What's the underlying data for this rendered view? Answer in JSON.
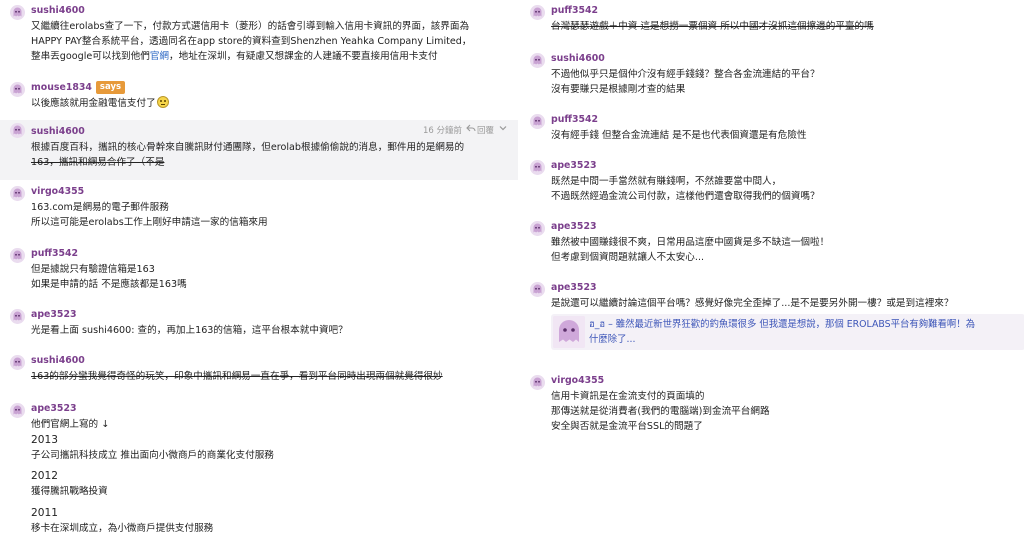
{
  "colors": {
    "username": "#7b3f8c",
    "link": "#2c68c5",
    "badge": "#e79a3a",
    "hover_bg": "#f3f3f5",
    "quote_text": "#3c55b8"
  },
  "icons": {
    "avatar": "ghost-avatar-icon",
    "reply": "reply-arrow-icon",
    "chevron": "chevron-down-icon",
    "emoji": "smiley-emoji-icon"
  },
  "left": [
    {
      "user": "sushi4600",
      "lines": [
        "又繼續往erolabs查了一下，付款方式選信用卡（菱形）的話會引導到輸入信用卡資訊的界面，該界面為",
        "HAPPY PAY整合系統平台，透過同名在app store的資料查到Shenzhen Yeahka Company Limited，",
        "整串丟google可以找到他們"
      ],
      "link_text": "官網",
      "tail": "，地址在深圳，有疑慮又想課金的人建議不要直接用信用卡支付"
    },
    {
      "user": "mouse1834",
      "badge": "says",
      "lines": [
        "以後應該就用金融電信支付了"
      ]
    },
    {
      "user": "sushi4600",
      "time": "16 分鐘前",
      "reply": "回覆",
      "lines": [
        "根據百度百科，攜訊的核心骨幹來自騰訊財付通團隊，但erolab根據偷偷說的消息，郵件用的是網易的"
      ],
      "strike_line": "163，攜訊和網易合作了（不是"
    },
    {
      "user": "virgo4355",
      "lines": [
        "163.com是網易的電子郵件服務",
        "所以這可能是erolabs工作上剛好申請這一家的信箱來用"
      ]
    },
    {
      "user": "puff3542",
      "lines": [
        "但是據說只有驗證信箱是163",
        "如果是申請的話 不是應該都是163嗎"
      ]
    },
    {
      "user": "ape3523",
      "lines": [
        "光是看上面 sushi4600: 查的，再加上163的信箱，這平台根本就中資吧？"
      ]
    },
    {
      "user": "sushi4600",
      "strike_lines": [
        "163的部分蠻我覺得奇怪的玩笑，印象中攜訊和網易一直在爭，看到平台同時出現兩個就覺得很妙"
      ]
    },
    {
      "user": "ape3523",
      "lines": [
        "他們官網上寫的 ↓"
      ],
      "years": [
        {
          "year": "2013",
          "text": "子公司攜訊科技成立 推出面向小微商戶的商業化支付服務"
        },
        {
          "year": "2012",
          "text": "獲得騰訊戰略投資"
        },
        {
          "year": "2011",
          "text": "移卡在深圳成立，為小微商戶提供支付服務"
        }
      ]
    }
  ],
  "right": [
    {
      "user": "puff3542",
      "strike_lines": [
        "台灣瑟瑟遊戲＋中資 這是想撈一票個資 所以中國才沒抓這個擦邊的平臺的嗎"
      ]
    },
    {
      "user": "sushi4600",
      "lines": [
        "不過他似乎只是個仲介沒有經手錢錢？整合各金流連結的平台？",
        "沒有要賺只是根據剛才查的結果"
      ]
    },
    {
      "user": "puff3542",
      "lines": [
        "沒有經手錢 但整合金流連結 是不是也代表個資還是有危險性"
      ]
    },
    {
      "user": "ape3523",
      "lines": [
        "既然是中間一手當然就有賺錢啊，不然誰要當中間人，",
        "不過既然經過金流公司付款，這樣他們還會取得我們的個資嗎？"
      ]
    },
    {
      "user": "ape3523",
      "lines": [
        "雖然被中國賺錢很不爽，日常用品這麼中國貨是多不缺這一個啦！",
        "但考慮到個資問題就讓人不太安心..."
      ]
    },
    {
      "user": "ape3523",
      "lines": [
        "是說還可以繼續討論這個平台嗎？感覺好像完全歪掉了...是不是要另外開一樓？或是到這裡來？"
      ],
      "quote": {
        "lines": [
          "ฮ_ฮ – 雖然最近新世界狂歡的釣魚環很多 但我還是想說，那個 EROLABS平台有夠難看啊！為",
          "什麼除了..."
        ]
      }
    },
    {
      "user": "virgo4355",
      "lines": [
        "信用卡資訊是在金流支付的頁面填的",
        "那傳送就是從消費者(我們的電腦端)到金流平台網路",
        "安全與否就是金流平台SSL的問題了"
      ]
    }
  ]
}
